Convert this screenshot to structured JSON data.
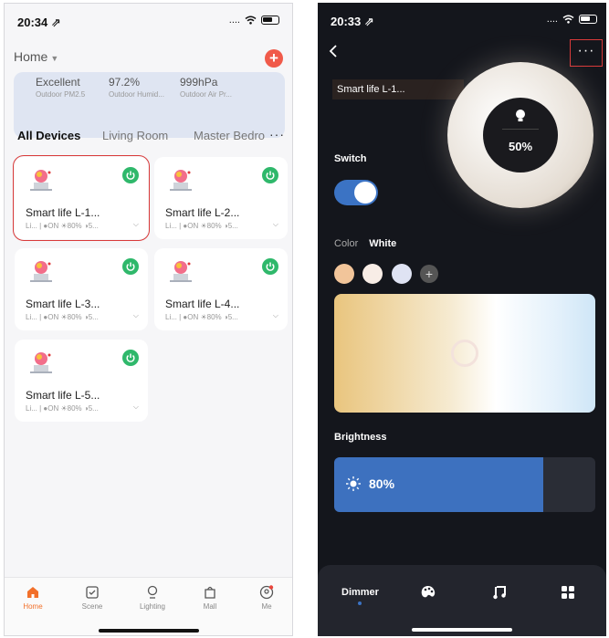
{
  "left": {
    "status_time": "20:34 ⇗",
    "signal": "....",
    "home": "Home",
    "weather": [
      {
        "value": "Excellent",
        "label": "Outdoor PM2.5"
      },
      {
        "value": "97.2%",
        "label": "Outdoor Humid..."
      },
      {
        "value": "999hPa",
        "label": "Outdoor Air Pr..."
      }
    ],
    "tabs": [
      "All Devices",
      "Living Room",
      "Master Bedro"
    ],
    "tabs_more": "···",
    "devices": [
      {
        "name": "Smart life L-1...",
        "meta": "Li...  |  ●ON  ☀80%  ◑5..."
      },
      {
        "name": "Smart life L-2...",
        "meta": "Li...  |  ●ON  ☀80%  ◑5..."
      },
      {
        "name": "Smart life L-3...",
        "meta": "Li...  |  ●ON  ☀80%  ◑5..."
      },
      {
        "name": "Smart life L-4...",
        "meta": "Li...  |  ●ON  ☀80%  ◑5..."
      },
      {
        "name": "Smart life L-5...",
        "meta": "Li...  |  ●ON  ☀80%  ◑5..."
      }
    ],
    "nav": [
      "Home",
      "Scene",
      "Lighting",
      "Mall",
      "Me"
    ]
  },
  "right": {
    "status_time": "20:33 ⇗",
    "signal": "....",
    "device_name": "Smart life L-1...",
    "more": "···",
    "dial_value": "50%",
    "switch_label": "Switch",
    "color_tabs": [
      "Color",
      "White"
    ],
    "brightness_label": "Brightness",
    "brightness_value": "80%",
    "brightness_level": 0.8,
    "swatches": [
      "#f2c59a",
      "#f8ede6",
      "#dfe3f3"
    ],
    "bottom_tabs": [
      "Dimmer"
    ]
  },
  "colors": {
    "accent_orange": "#f2702a",
    "power_green": "#2fb86b",
    "add_red": "#f05a4a",
    "toggle_blue": "#3b73c4",
    "brightness_blue": "#3d71bf",
    "highlight_red": "#d93a3a"
  },
  "icons": {
    "left_nav": [
      "home-icon",
      "scene-icon",
      "lighting-icon",
      "mall-icon",
      "me-icon"
    ],
    "right_tabs": [
      "dimmer-tab",
      "palette-icon",
      "music-icon",
      "grid-icon"
    ]
  }
}
